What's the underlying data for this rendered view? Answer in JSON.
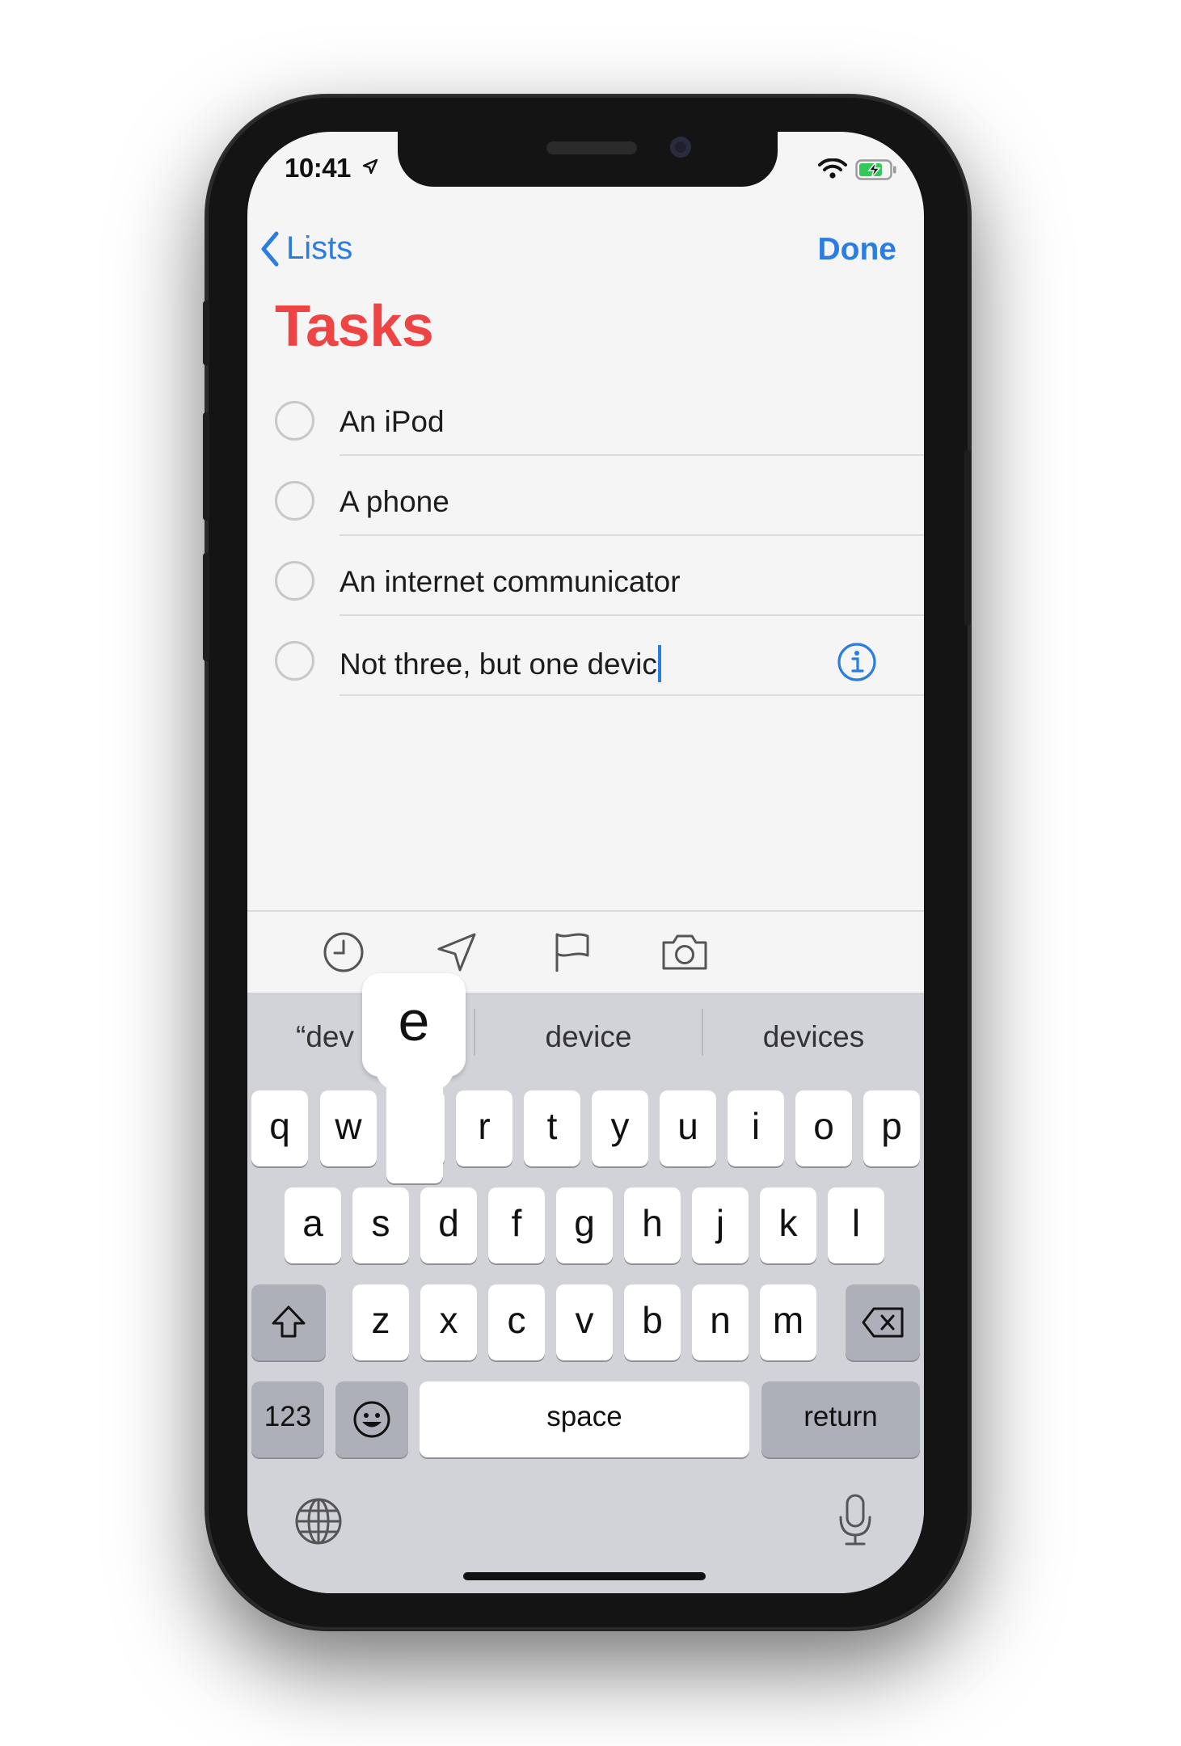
{
  "status_bar": {
    "time": "10:41"
  },
  "nav": {
    "back_label": "Lists",
    "done_label": "Done"
  },
  "list": {
    "title": "Tasks",
    "items": [
      {
        "text": "An iPod"
      },
      {
        "text": "A phone"
      },
      {
        "text": "An internet communicator"
      },
      {
        "text": "Not three, but one devic"
      }
    ]
  },
  "toolbar": {
    "icons": [
      "clock-icon",
      "location-arrow-icon",
      "flag-icon",
      "camera-icon"
    ]
  },
  "keyboard": {
    "suggestions": [
      "“dev",
      "device",
      "devices"
    ],
    "popup_key": "e",
    "row1": [
      "q",
      "w",
      "e",
      "r",
      "t",
      "y",
      "u",
      "i",
      "o",
      "p"
    ],
    "row2": [
      "a",
      "s",
      "d",
      "f",
      "g",
      "h",
      "j",
      "k",
      "l"
    ],
    "row3": [
      "z",
      "x",
      "c",
      "v",
      "b",
      "n",
      "m"
    ],
    "numbers_label": "123",
    "space_label": "space",
    "return_label": "return"
  },
  "colors": {
    "accent": "#2a7de1",
    "title": "#ef4444"
  }
}
